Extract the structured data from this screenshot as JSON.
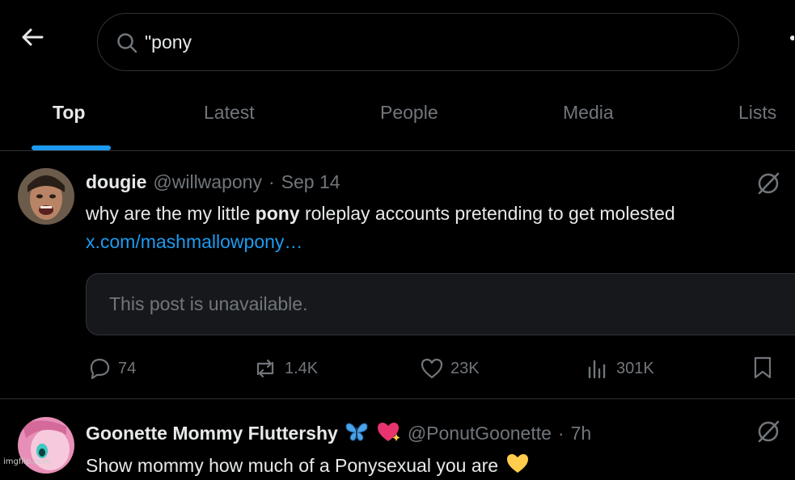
{
  "search": {
    "query": "\"pony"
  },
  "tabs": [
    {
      "label": "Top"
    },
    {
      "label": "Latest"
    },
    {
      "label": "People"
    },
    {
      "label": "Media"
    },
    {
      "label": "Lists"
    }
  ],
  "posts": [
    {
      "display_name": "dougie",
      "handle": "@willwapony",
      "separator": "·",
      "time": "Sep 14",
      "text_before": "why are the my little ",
      "text_bold": "pony",
      "text_after": " roleplay accounts pretending to get molested",
      "link": "x.com/mashmallowpony…",
      "quote_unavailable": "This post is unavailable.",
      "replies": "74",
      "reposts": "1.4K",
      "likes": "23K",
      "views": "301K"
    },
    {
      "display_name": "Goonette Mommy Fluttershy",
      "name_emojis": [
        "butterfly-emoji",
        "sparkling-heart-emoji"
      ],
      "handle": "@PonutGoonette",
      "separator": "·",
      "time": "7h",
      "text": "Show mommy how much of a Ponysexual you are",
      "text_emoji": "yellow-heart-emoji"
    }
  ],
  "watermark": "imgflip.com",
  "colors": {
    "accent": "#1d9bf0",
    "muted": "#71767b",
    "text": "#e7e9ea",
    "border": "#2f3336"
  }
}
